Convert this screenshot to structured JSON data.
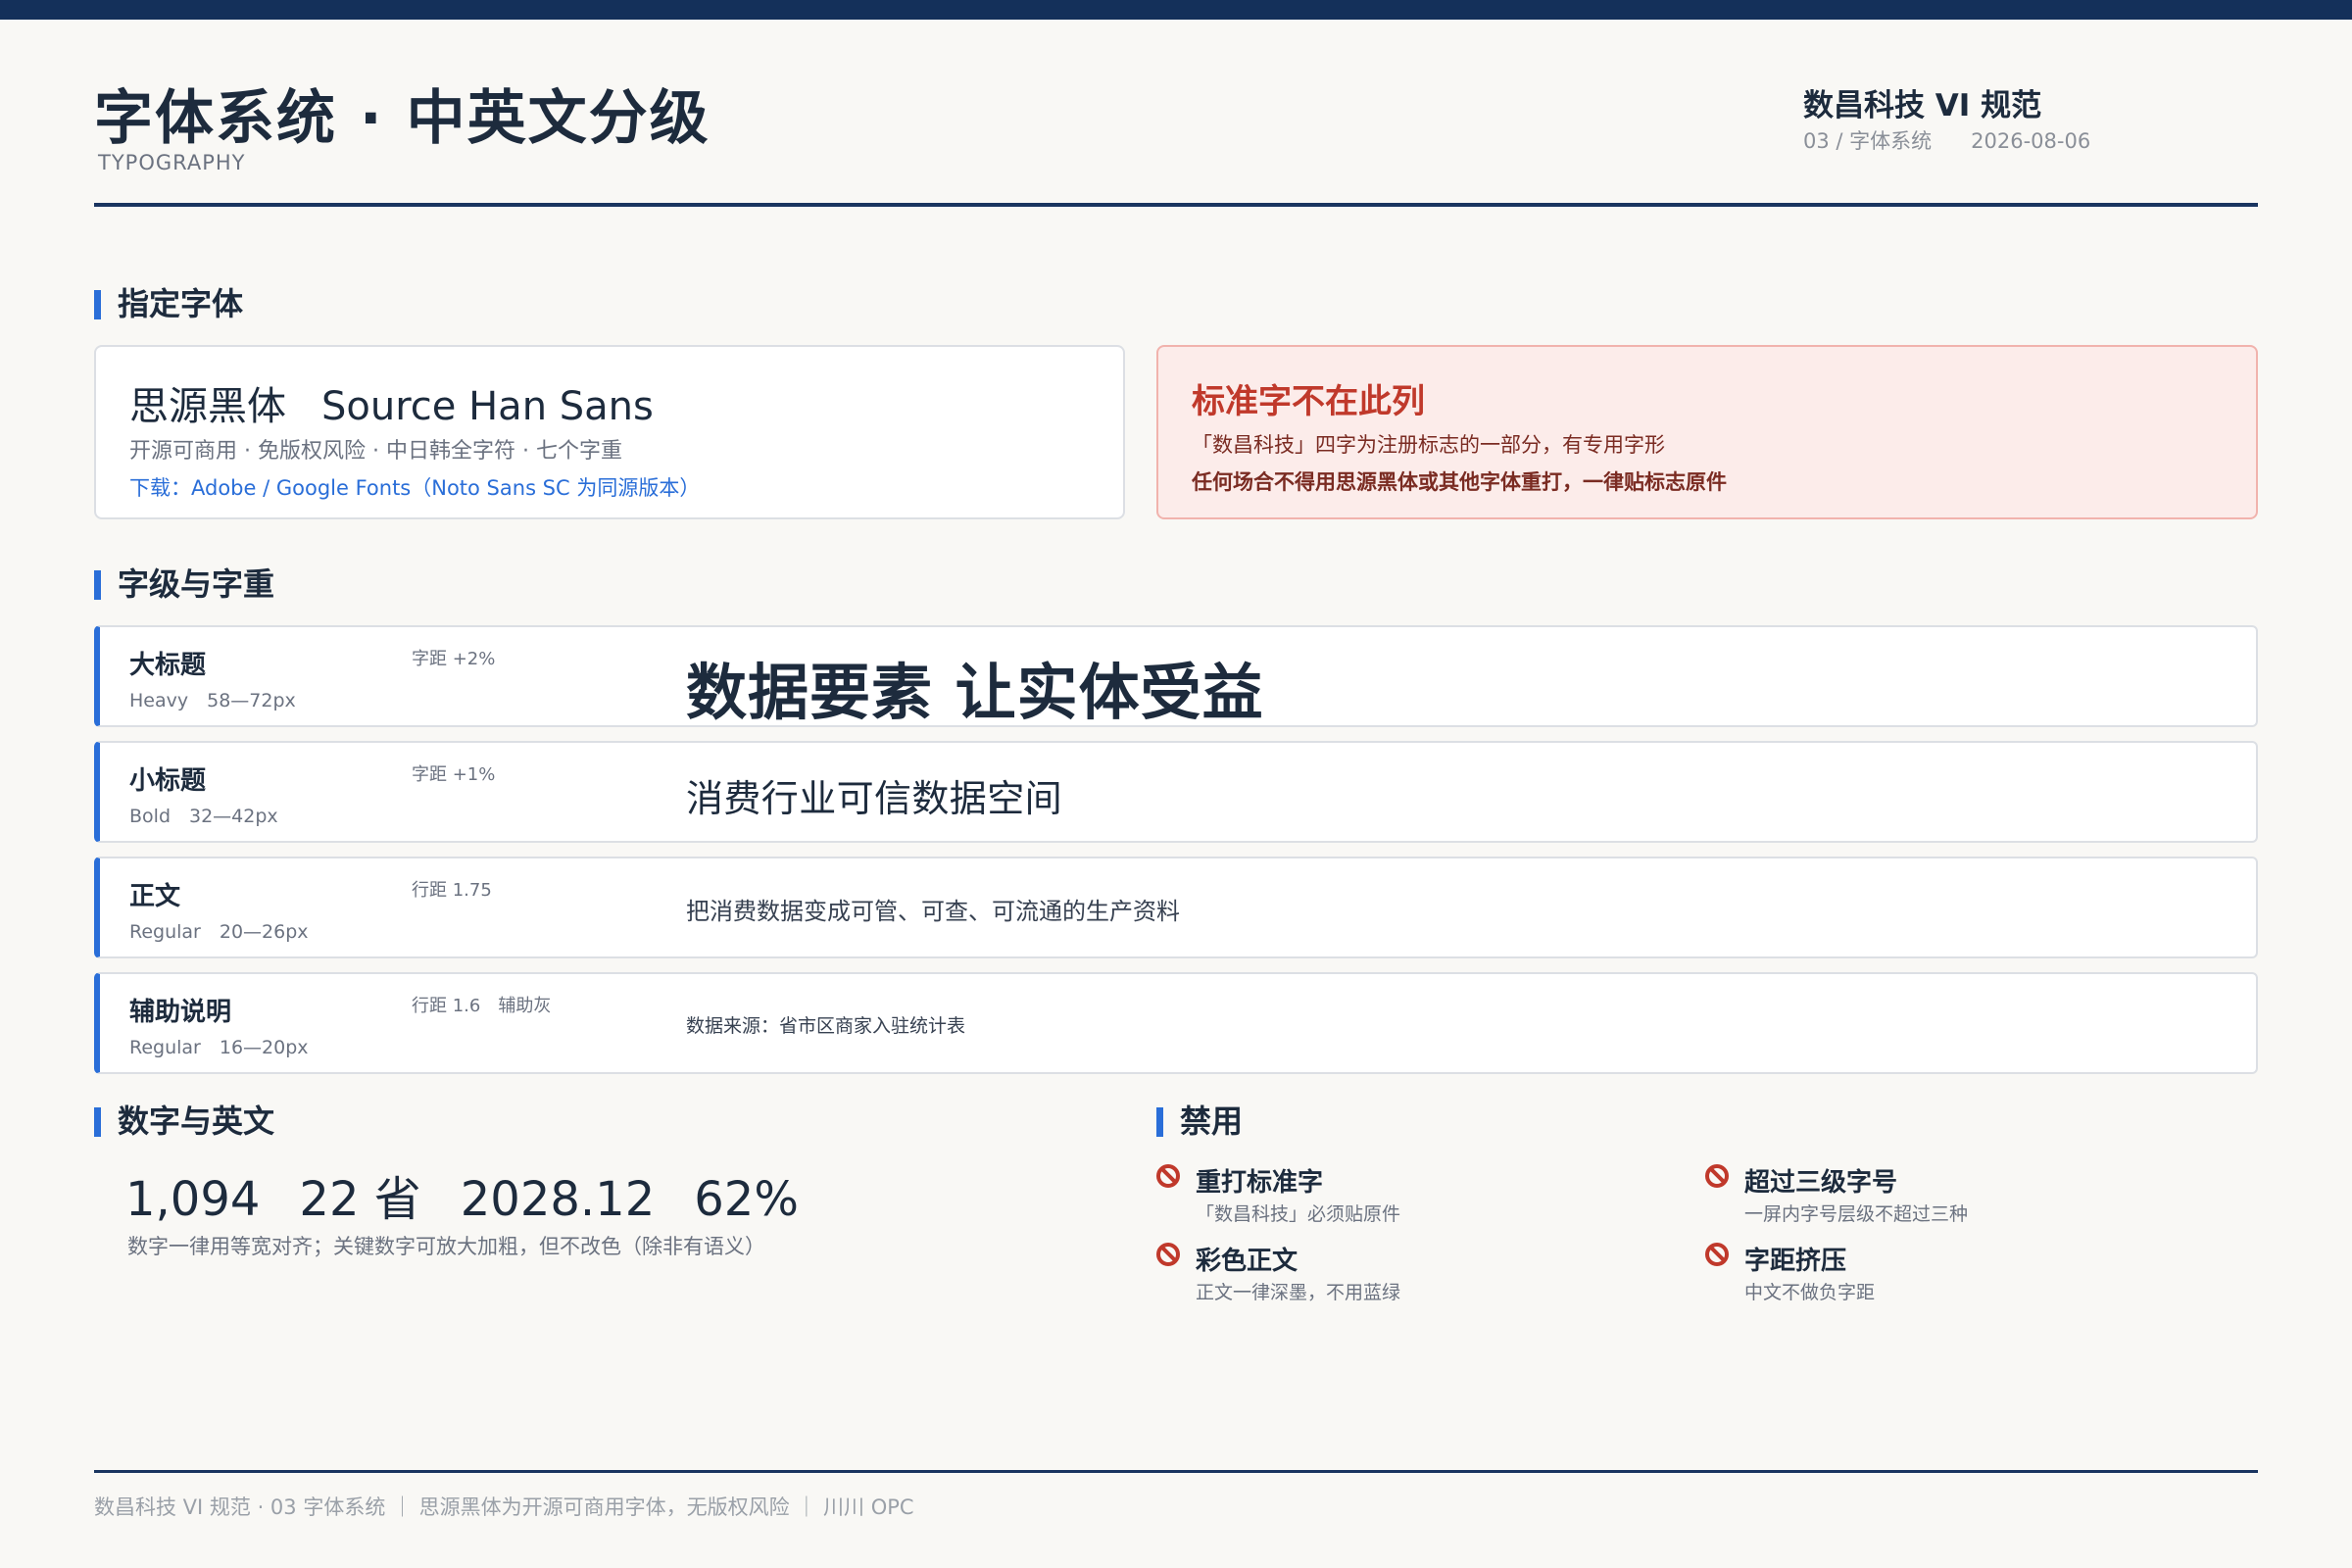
{
  "header": {
    "title": "字体系统 · 中英文分级",
    "subtitle": "TYPOGRAPHY",
    "brand": "数昌科技 VI 规范",
    "section": "03 / 字体系统",
    "date": "2026-08-06"
  },
  "designated": {
    "heading": "指定字体",
    "font_cn": "思源黑体",
    "font_en": "Source Han Sans",
    "desc": "开源可商用 · 免版权风险 · 中日韩全字符 · 七个字重",
    "download": "下载：Adobe / Google Fonts（Noto Sans SC 为同源版本）"
  },
  "warning": {
    "title": "标准字不在此列",
    "line1": "「数昌科技」四字为注册标志的一部分，有专用字形",
    "line2": "任何场合不得用思源黑体或其他字体重打，一律贴标志原件"
  },
  "levels": {
    "heading": "字级与字重",
    "rows": [
      {
        "name": "大标题",
        "spec": "Heavy　58—72px",
        "param": "字距 +2%",
        "sample": "数据要素 让实体受益"
      },
      {
        "name": "小标题",
        "spec": "Bold　32—42px",
        "param": "字距 +1%",
        "sample": "消费行业可信数据空间"
      },
      {
        "name": "正文",
        "spec": "Regular　20—26px",
        "param": "行距 1.75",
        "sample": "把消费数据变成可管、可查、可流通的生产资料"
      },
      {
        "name": "辅助说明",
        "spec": "Regular　16—20px",
        "param": "行距 1.6　辅助灰",
        "sample": "数据来源：省市区商家入驻统计表"
      }
    ]
  },
  "numbers": {
    "heading": "数字与英文",
    "items": [
      "1,094",
      "22 省",
      "2028.12",
      "62%"
    ],
    "note": "数字一律用等宽对齐；关键数字可放大加粗，但不改色（除非有语义）"
  },
  "banned": {
    "heading": "禁用",
    "items": [
      {
        "title": "重打标准字",
        "desc": "「数昌科技」必须贴原件"
      },
      {
        "title": "超过三级字号",
        "desc": "一屏内字号层级不超过三种"
      },
      {
        "title": "彩色正文",
        "desc": "正文一律深墨，不用蓝绿"
      },
      {
        "title": "字距挤压",
        "desc": "中文不做负字距"
      }
    ]
  },
  "footer": "数昌科技 VI 规范 · 03 字体系统 ｜ 思源黑体为开源可商用字体，无版权风险 ｜ 川川 OPC",
  "colors": {
    "accent": "#2a6ed8",
    "navy": "#14305a",
    "danger": "#c0392b",
    "background": "#f9f8f5"
  }
}
